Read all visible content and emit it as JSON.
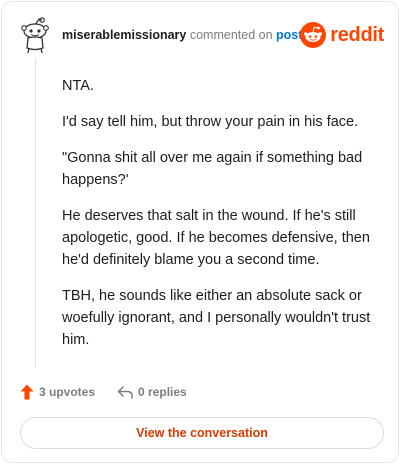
{
  "comment": {
    "username": "miserablemissionary",
    "action": "commented on",
    "post_link": "post",
    "paragraphs": [
      "NTA.",
      "I'd say tell him, but throw your pain in his face.",
      "\"Gonna shit all over me again if something bad happens?'",
      "He deserves that salt in the wound. If he's still apologetic, good. If he becomes defensive, then he'd definitely blame you a second time.",
      "TBH, he sounds like either an absolute sack or woefully ignorant, and I personally wouldn't trust him."
    ],
    "upvotes": "3 upvotes",
    "replies": "0 replies"
  },
  "brand": {
    "name": "reddit",
    "color": "#ff4500"
  },
  "cta": {
    "label": "View the conversation"
  },
  "icons": {
    "avatar": "snoo-avatar-icon",
    "logo": "reddit-logo-icon",
    "upvote": "upvote-arrow-icon",
    "reply": "reply-arrow-icon"
  },
  "colors": {
    "accent": "#ff4500",
    "link": "#0079d3",
    "cta_text": "#d93a00"
  }
}
